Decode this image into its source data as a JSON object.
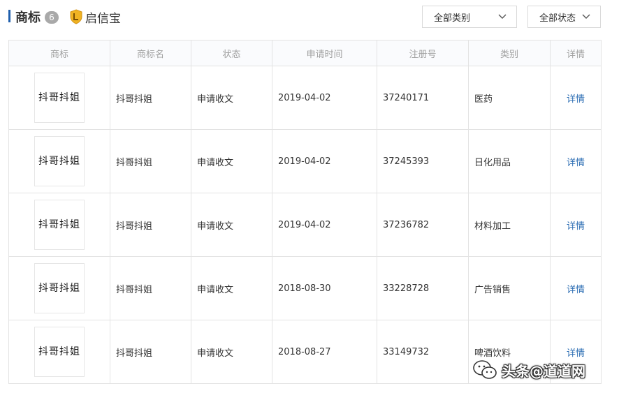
{
  "header": {
    "title": "商标",
    "count": "6",
    "brand_label": "启信宝"
  },
  "filters": {
    "category": "全部类别",
    "status": "全部状态"
  },
  "table": {
    "columns": [
      "商标",
      "商标名",
      "状态",
      "申请时间",
      "注册号",
      "类别",
      "详情"
    ],
    "rows": [
      {
        "logo_text": "抖哥抖姐",
        "name": "抖哥抖姐",
        "status": "申请收文",
        "date": "2019-04-02",
        "reg_no": "37240171",
        "category": "医药",
        "detail": "详情"
      },
      {
        "logo_text": "抖哥抖姐",
        "name": "抖哥抖姐",
        "status": "申请收文",
        "date": "2019-04-02",
        "reg_no": "37245393",
        "category": "日化用品",
        "detail": "详情"
      },
      {
        "logo_text": "抖哥抖姐",
        "name": "抖哥抖姐",
        "status": "申请收文",
        "date": "2019-04-02",
        "reg_no": "37236782",
        "category": "材料加工",
        "detail": "详情"
      },
      {
        "logo_text": "抖哥抖姐",
        "name": "抖哥抖姐",
        "status": "申请收文",
        "date": "2018-08-30",
        "reg_no": "33228728",
        "category": "广告销售",
        "detail": "详情"
      },
      {
        "logo_text": "抖哥抖姐",
        "name": "抖哥抖姐",
        "status": "申请收文",
        "date": "2018-08-27",
        "reg_no": "33149732",
        "category": "啤酒饮料",
        "detail": "详情"
      }
    ]
  },
  "watermark": {
    "text": "头条@道道网",
    "icon": "wechat-icon"
  },
  "colors": {
    "accent": "#1f5fad",
    "link": "#2a6cb3",
    "shield": "#f0b323"
  }
}
